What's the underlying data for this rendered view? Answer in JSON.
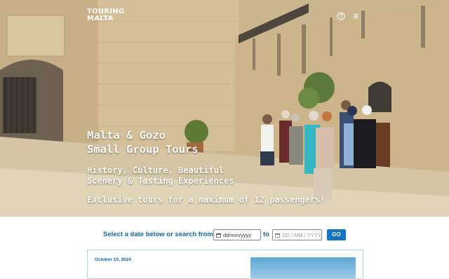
{
  "header": {
    "logo_line1": "TOURING",
    "logo_line2": "MALTA",
    "icons": [
      "help-icon",
      "menu-icon"
    ]
  },
  "hero": {
    "title_line1": "Malta & Gozo",
    "title_line2": "Small Group Tours",
    "subtitle_line1": "History, Culture, Beautiful",
    "subtitle_line2": "Scenery & Tasting Experiences",
    "exclusive": "Exclusive tours for a maximum of 12 passengers!"
  },
  "search": {
    "label": "Select a date below or search from",
    "from_value": "dd/mm/yyyy",
    "to_label": "to",
    "to_placeholder": "DD / MM / YYYY",
    "go_label": "GO"
  },
  "tour_card": {
    "date": "October 10, 2024"
  },
  "colors": {
    "accent_blue": "#1565a8",
    "button_blue": "#1474c4",
    "card_border": "#b8d3ea"
  }
}
